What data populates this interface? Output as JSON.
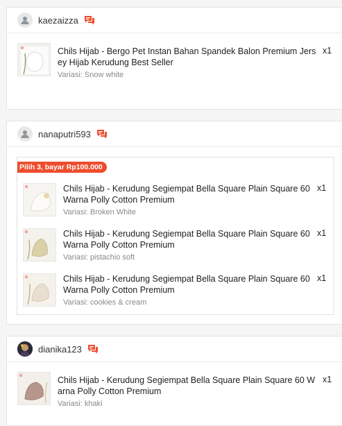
{
  "orders": [
    {
      "username": "kaezaizza",
      "items": [
        {
          "title": "Chils Hijab - Bergo Pet Instan Bahan Spandek Balon Premium Jersey Hijab Kerudung Best Seller",
          "qty": "x1",
          "variant": "Variasi: Snow white"
        }
      ]
    },
    {
      "username": "nanaputri593",
      "bundle_badge": "Pilih 3, bayar Rp100.000",
      "items": [
        {
          "title": "Chils Hijab - Kerudung Segiempat Bella Square Plain Square 60 Warna Polly Cotton Premium",
          "qty": "x1",
          "variant": "Variasi: Broken White"
        },
        {
          "title": "Chils Hijab - Kerudung Segiempat Bella Square Plain Square 60 Warna Polly Cotton Premium",
          "qty": "x1",
          "variant": "Variasi: pistachio soft"
        },
        {
          "title": "Chils Hijab - Kerudung Segiempat Bella Square Plain Square 60 Warna Polly Cotton Premium",
          "qty": "x1",
          "variant": "Variasi: cookies & cream"
        }
      ]
    },
    {
      "username": "dianika123",
      "items": [
        {
          "title": "Chils Hijab - Kerudung Segiempat Bella Square Plain Square 60 Warna Polly Cotton Premium",
          "qty": "x1",
          "variant": "Variasi: khaki"
        }
      ]
    }
  ],
  "colors": {
    "accent": "#ee4d2d",
    "chat_icon": "#ee4d2d"
  },
  "icons": {
    "avatar_placeholder": "user-icon",
    "chat": "chat-icon"
  }
}
